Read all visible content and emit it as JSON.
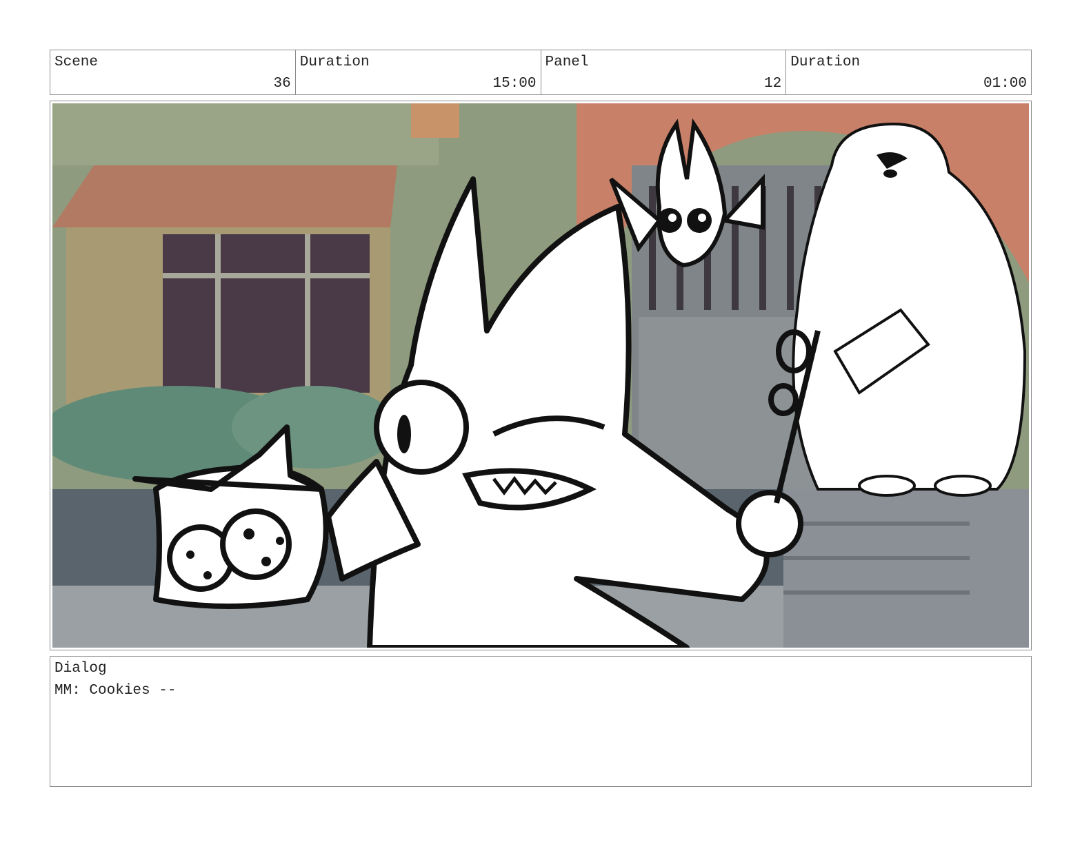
{
  "header": {
    "scene": {
      "label": "Scene",
      "value": "36"
    },
    "scene_duration": {
      "label": "Duration",
      "value": "15:00"
    },
    "panel": {
      "label": "Panel",
      "value": "12"
    },
    "panel_duration": {
      "label": "Duration",
      "value": "01:00"
    }
  },
  "dialog": {
    "label": "Dialog",
    "text": "MM: Cookies --"
  },
  "colors": {
    "border": "#8a8a8a",
    "bg_green": "#8e9b7e",
    "roof": "#b27a62",
    "window_dark": "#4a3a48",
    "ink": "#111111"
  }
}
